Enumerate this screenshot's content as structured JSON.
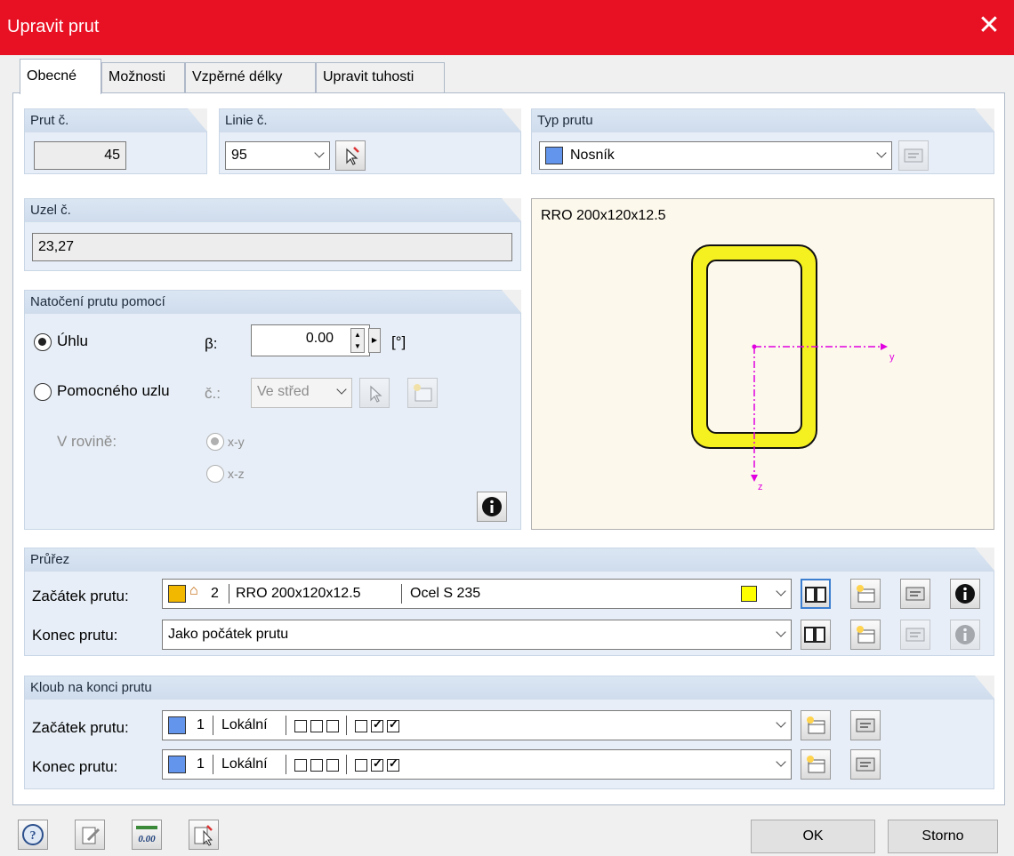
{
  "window": {
    "title": "Upravit prut",
    "close": "✕"
  },
  "tabs": [
    "Obecné",
    "Možnosti",
    "Vzpěrné délky",
    "Upravit tuhosti"
  ],
  "member_no": {
    "label": "Prut č.",
    "value": "45"
  },
  "line_no": {
    "label": "Linie č.",
    "value": "95"
  },
  "member_type": {
    "label": "Typ prutu",
    "value": "Nosník",
    "color": "#6495ed"
  },
  "node_no": {
    "label": "Uzel č.",
    "value": "23,27"
  },
  "rotation": {
    "label": "Natočení prutu pomocí",
    "angle_option": "Úhlu",
    "beta_label": "β:",
    "beta_value": "0.00",
    "unit": "[°]",
    "node_option": "Pomocného uzlu",
    "node_no_label": "č.:",
    "node_select": "Ve střed",
    "plane_label": "V rovině:",
    "plane_xy": "x-y",
    "plane_xz": "x-z"
  },
  "preview": {
    "caption": "RRO 200x120x12.5",
    "axis_y": "y",
    "axis_z": "z",
    "section_color": "#f5f020"
  },
  "cross_section": {
    "label": "Průřez",
    "start_label": "Začátek prutu:",
    "start_number": "2",
    "start_name": "RRO 200x120x12.5",
    "start_material": "Ocel S 235",
    "start_color": "#f2b800",
    "material_color": "#ffff00",
    "end_label": "Konec prutu:",
    "end_value": "Jako počátek prutu"
  },
  "hinges": {
    "label": "Kloub na konci prutu",
    "rows": [
      {
        "label": "Začátek prutu:",
        "number": "1",
        "system": "Lokální"
      },
      {
        "label": "Konec prutu:",
        "number": "1",
        "system": "Lokální"
      }
    ],
    "color": "#6495ed"
  },
  "buttons": {
    "ok": "OK",
    "cancel": "Storno"
  },
  "icons": [
    "help-icon",
    "edit-icon",
    "units-icon",
    "select-icon",
    "pick-icon",
    "new-icon",
    "edit-object-icon",
    "library-icon",
    "info-icon"
  ]
}
